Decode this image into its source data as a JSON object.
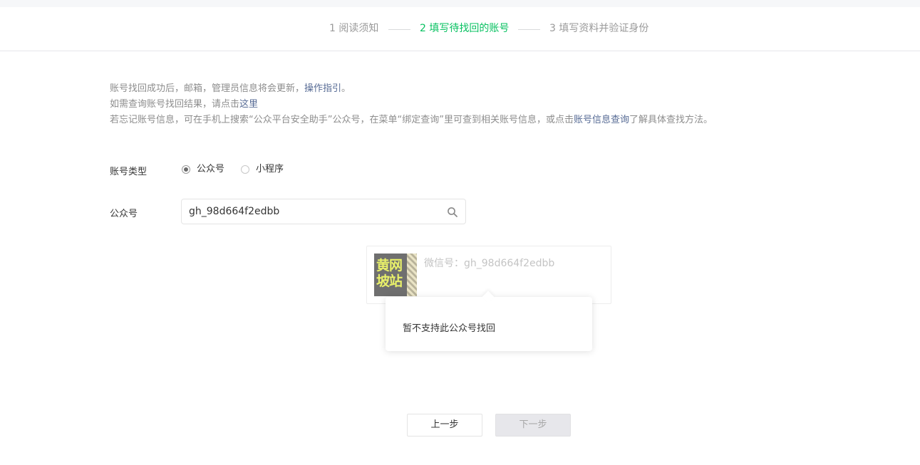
{
  "steps": {
    "step1": "1 阅读须知",
    "step2": "2 填写待找回的账号",
    "step3": "3 填写资料并验证身份"
  },
  "notice": {
    "line1_text": "账号找回成功后，邮箱，管理员信息将会更新，",
    "line1_link": "操作指引",
    "line1_end": "。",
    "line2_text": "如需查询账号找回结果，请点击",
    "line2_link": "这里",
    "line3_text": "若忘记账号信息，可在手机上搜索“公众平台安全助手”公众号，在菜单“绑定查询”里可查到相关账号信息，或点击",
    "line3_link": "账号信息查询",
    "line3_end": "了解具体查找方法。"
  },
  "form": {
    "type_label": "账号类型",
    "options": [
      {
        "label": "公众号",
        "checked": true
      },
      {
        "label": "小程序",
        "checked": false
      }
    ],
    "account_label": "公众号",
    "account_value": "gh_98d664f2edbb"
  },
  "result": {
    "avatar_text": "黄网\n坡站",
    "wechat_id": "微信号：gh_98d664f2edbb",
    "tooltip": "暂不支持此公众号找回"
  },
  "buttons": {
    "prev": "上一步",
    "next": "下一步"
  },
  "colors": {
    "accent": "#07c160",
    "link": "#576b95",
    "muted_text": "#8d8d8d"
  },
  "icons": {
    "search": "search-icon"
  }
}
